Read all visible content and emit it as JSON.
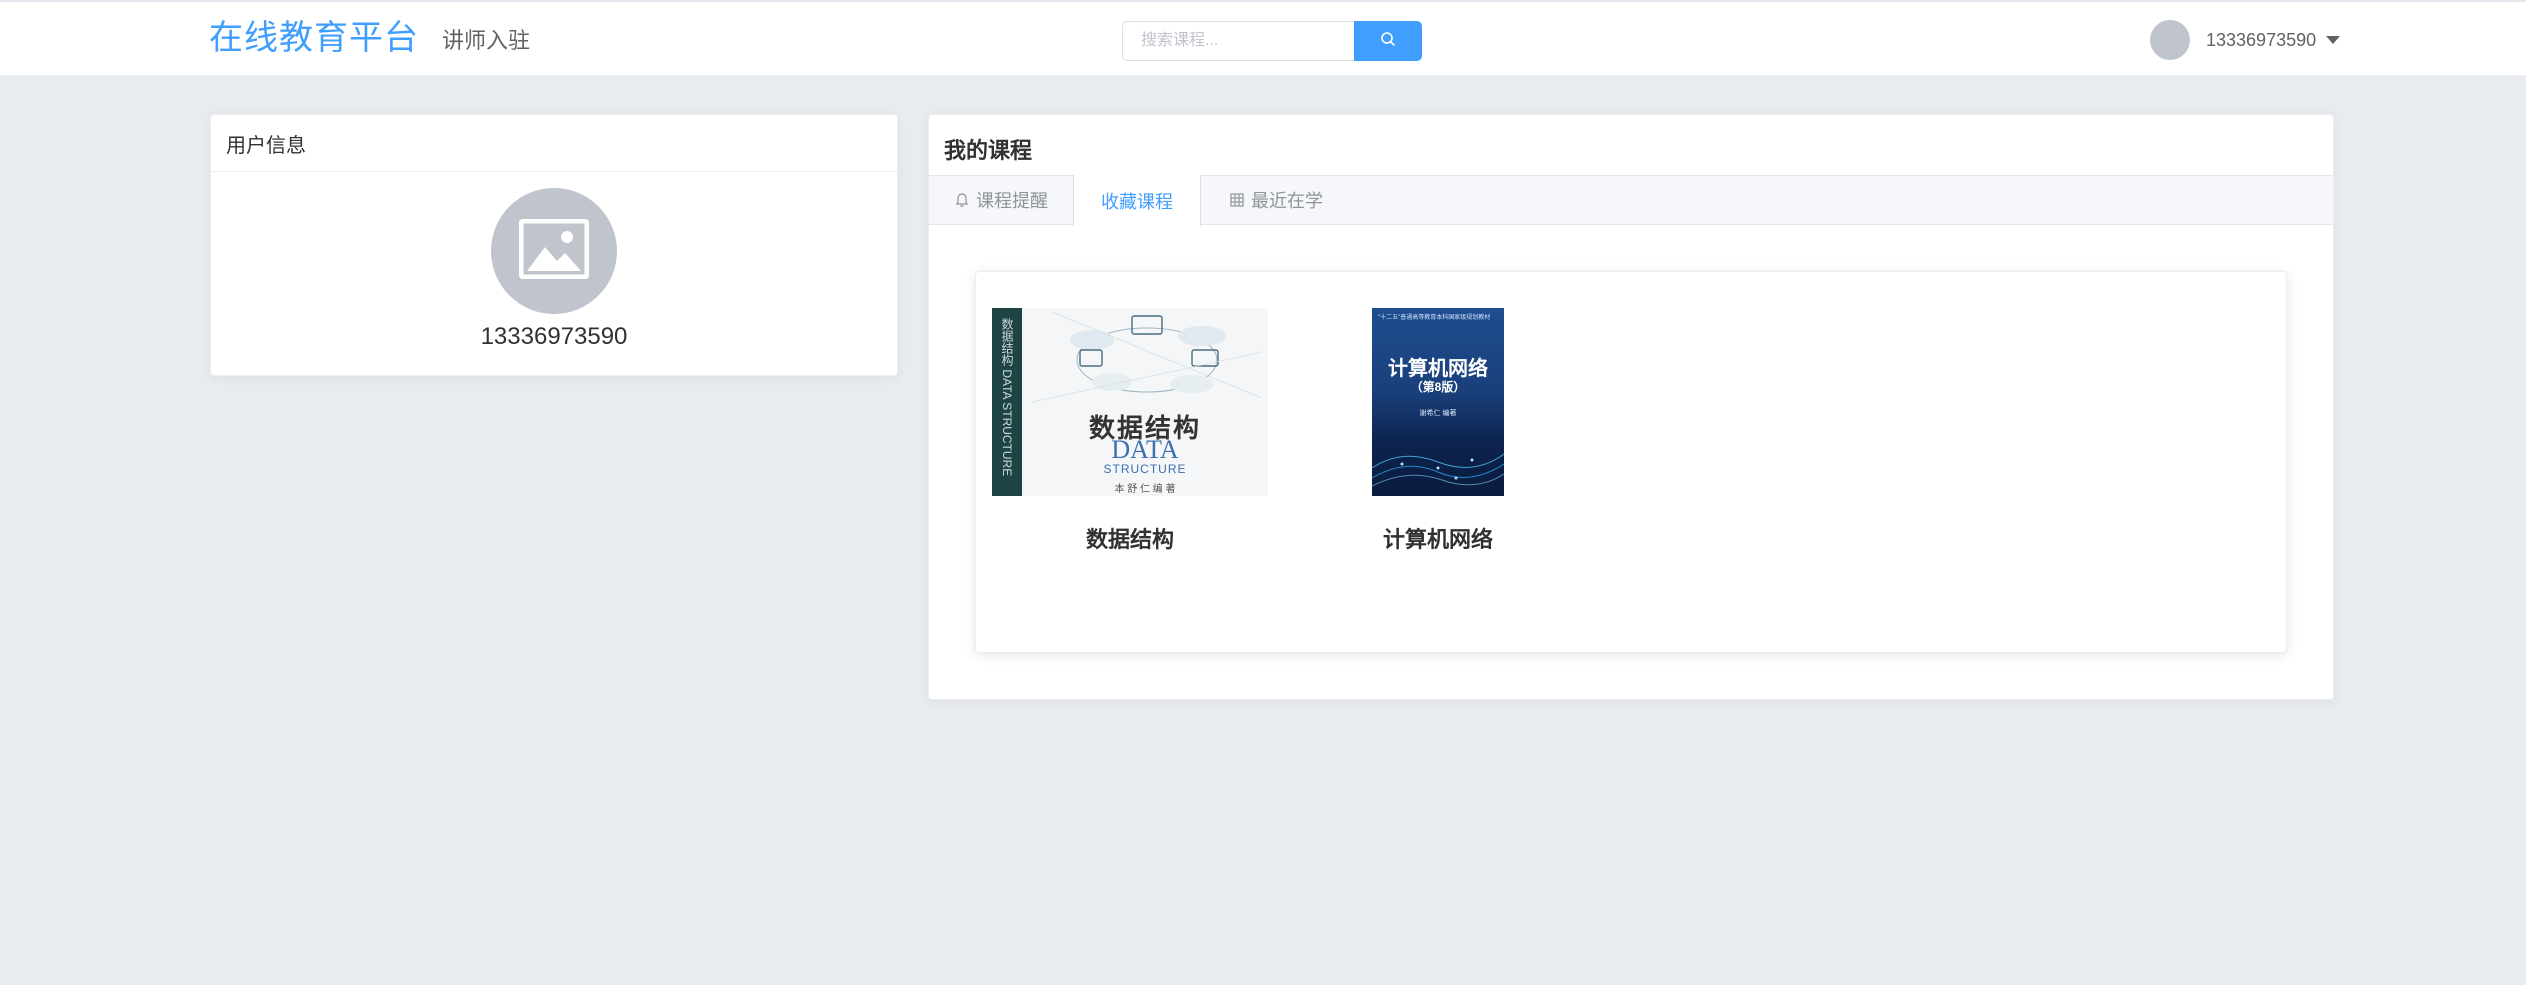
{
  "header": {
    "logo": "在线教育平台",
    "teacher_link": "讲师入驻",
    "search_placeholder": "搜索课程...",
    "username": "13336973590"
  },
  "user_card": {
    "title": "用户信息",
    "phone": "13336973590"
  },
  "courses_card": {
    "title": "我的课程",
    "tabs": [
      {
        "label": "课程提醒",
        "icon": "bell-icon",
        "active": false
      },
      {
        "label": "收藏课程",
        "icon": "",
        "active": true
      },
      {
        "label": "最近在学",
        "icon": "grid-icon",
        "active": false
      }
    ],
    "courses": [
      {
        "title": "数据结构",
        "cover": {
          "title_cn": "数据结构",
          "title_en": "DATA",
          "title_en_2": "STRUCTURE",
          "spine": "数据结构 DATA STRUCTURE",
          "author": "本 舒 仁 编 著"
        }
      },
      {
        "title": "计算机网络",
        "cover": {
          "series": "\"十二五\"普通高等教育本科国家级规划教材",
          "title_cn": "计算机网络",
          "edition": "（第8版）",
          "author": "谢希仁 编著"
        }
      }
    ]
  },
  "colors": {
    "accent": "#409eff",
    "page_background": "#e9ecef",
    "avatar_placeholder": "#c0c4cc"
  }
}
